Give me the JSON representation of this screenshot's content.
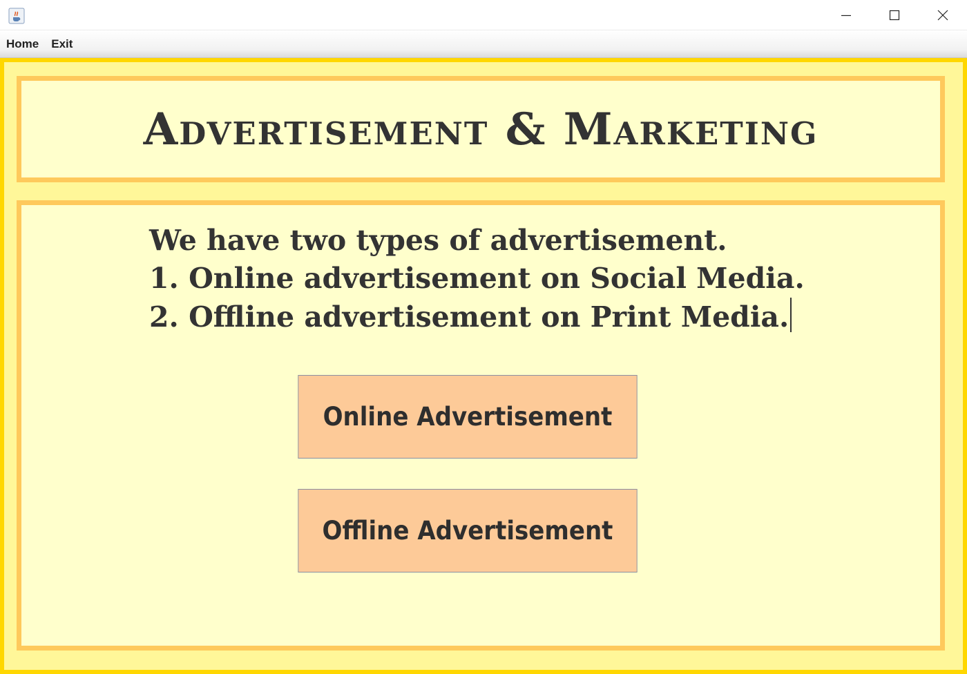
{
  "window": {
    "title": "",
    "icon": "java-cup-icon",
    "controls": [
      "minimize-icon",
      "maximize-icon",
      "close-icon"
    ]
  },
  "menubar": {
    "items": [
      {
        "label": "Home"
      },
      {
        "label": "Exit"
      }
    ]
  },
  "header": {
    "title": "Advertisement & Marketing"
  },
  "main": {
    "description": [
      "We have two types of advertisement.",
      "1. Online advertisement on Social Media.",
      "2. Offline advertisement on Print Media."
    ],
    "buttons": {
      "online": "Online Advertisement",
      "offline": "Offline Advertisement"
    }
  },
  "colors": {
    "outer_border": "#ffd700",
    "background": "#fff799",
    "panel_border": "#fec95c",
    "panel_fill": "#ffffcc",
    "button_fill": "#fdca98",
    "text": "#333333"
  }
}
